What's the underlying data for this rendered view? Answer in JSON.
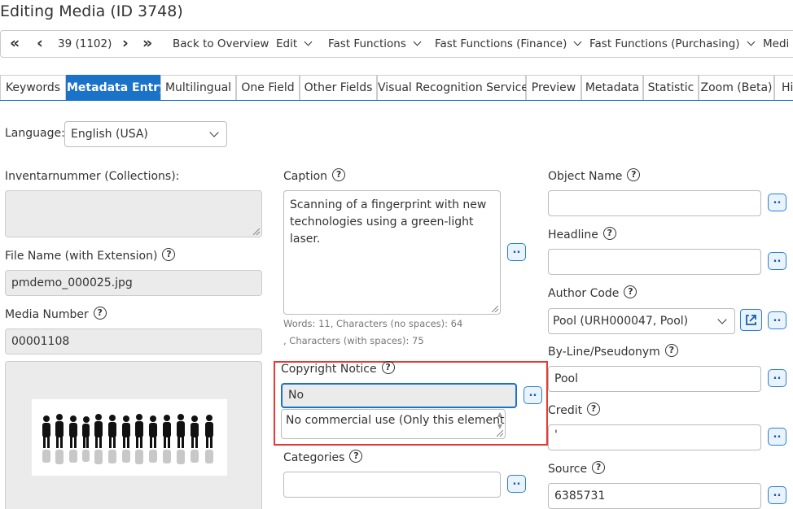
{
  "page_title": "Editing Media (ID 3748)",
  "toolbar": {
    "counter": "39 (1102)",
    "back": "Back to Overview",
    "edit": "Edit",
    "fast_functions": "Fast Functions",
    "fast_functions_finance": "Fast Functions (Finance)",
    "fast_functions_purchasing": "Fast Functions (Purchasing)",
    "media": "Medi"
  },
  "tabs": [
    "Keywords",
    "Metadata Entry",
    "Multilingual",
    "One Field",
    "Other Fields",
    "Visual Recognition Service",
    "Preview",
    "Metadata",
    "Statistic",
    "Zoom (Beta)",
    "Hi"
  ],
  "language": {
    "label": "Language:",
    "value": "English (USA)"
  },
  "left": {
    "inventory_label": "Inventarnummer (Collections):",
    "inventory_value": "",
    "filename_label": "File Name (with Extension)",
    "filename_value": "pmdemo_000025.jpg",
    "media_number_label": "Media Number",
    "media_number_value": "00001108"
  },
  "middle": {
    "caption_label": "Caption",
    "caption_value": "Scanning of a fingerprint with  new technologies using a green-light laser.",
    "caption_stats_1": "Words: 11, Characters (no spaces): 64",
    "caption_stats_2": ", Characters (with spaces): 75",
    "copyright_label": "Copyright Notice",
    "copyright_value": "No",
    "copyright_suggestion": "No commercial use   (Only this element)",
    "categories_label": "Categories",
    "categories_value": ""
  },
  "right": {
    "object_name_label": "Object Name",
    "object_name_value": "",
    "headline_label": "Headline",
    "headline_value": "",
    "author_code_label": "Author Code",
    "author_code_value": "Pool (URH000047, Pool)",
    "byline_label": "By-Line/Pseudonym",
    "byline_value": "Pool",
    "credit_label": "Credit",
    "credit_value": "'",
    "source_label": "Source",
    "source_value": "6385731"
  },
  "more_button_label": "..",
  "help_icon_glyph": "?",
  "colors": {
    "accent": "#1a73c8",
    "highlight": "#e53935"
  }
}
